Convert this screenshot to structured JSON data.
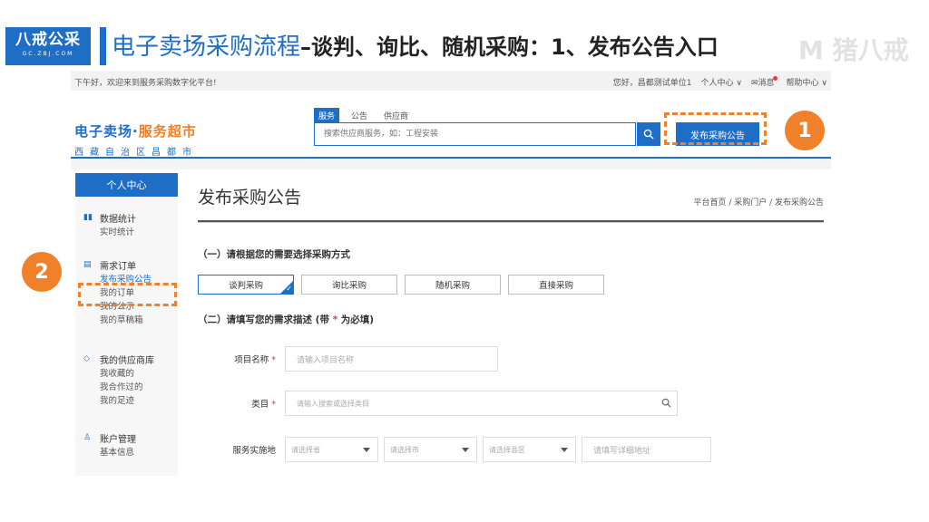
{
  "slide": {
    "logo_main": "八戒公采",
    "logo_sub": "GC.ZBJ.COM",
    "title_part1": "电子卖场采购流程",
    "title_part2": "–谈判、询比、随机采购：1、发布公告入口",
    "watermark": "M 猪八戒",
    "step1": "1",
    "step2": "2"
  },
  "topbar": {
    "greeting": "下午好，欢迎来到服务采购数字化平台!",
    "user": "您好，昌都测试单位1",
    "personal_center": "个人中心 ∨",
    "messages": "消息",
    "help_center": "帮助中心 ∨"
  },
  "brand": {
    "line1_a": "电子卖场·",
    "line1_b": "服务超市",
    "line2": "西藏自治区昌都市"
  },
  "search": {
    "tabs": [
      "服务",
      "公告",
      "供应商"
    ],
    "placeholder": "搜索供应商服务，如：工程安装",
    "publish_button": "发布采购公告"
  },
  "sidebar": {
    "header": "个人中心",
    "groups": [
      {
        "title": "数据统计",
        "icon": "bar-chart-icon",
        "items": [
          "实时统计"
        ]
      },
      {
        "title": "需求订单",
        "icon": "document-icon",
        "items": [
          "发布采购公告",
          "我的订单",
          "我的公示",
          "我的草稿箱"
        ]
      },
      {
        "title": "我的供应商库",
        "icon": "diamond-icon",
        "items": [
          "我收藏的",
          "我合作过的",
          "我的足迹"
        ]
      },
      {
        "title": "账户管理",
        "icon": "user-icon",
        "items": [
          "基本信息"
        ]
      }
    ]
  },
  "main": {
    "title": "发布采购公告",
    "breadcrumb": "平台首页 / 采购门户 / 发布采购公告",
    "section1": "（一）请根据您的需要选择采购方式",
    "methods": [
      "谈判采购",
      "询比采购",
      "随机采购",
      "直接采购"
    ],
    "selected_method": "谈判采购",
    "section2_a": "（二）请填写您的需求描述 (带 ",
    "section2_star": "*",
    "section2_b": " 为必填)",
    "form": {
      "project_name_label": "项目名称",
      "project_name_placeholder": "请输入项目名称",
      "category_label": "类目",
      "category_placeholder": "请输入搜索或选择类目",
      "location_label": "服务实施地",
      "province_placeholder": "请选择省",
      "city_placeholder": "请选择市",
      "district_placeholder": "请选择县区",
      "address_placeholder": "请填写详细地址",
      "required_mark": "*"
    }
  },
  "colors": {
    "primary": "#1e6ec8",
    "accent": "#f0802a",
    "required": "#e53935"
  }
}
